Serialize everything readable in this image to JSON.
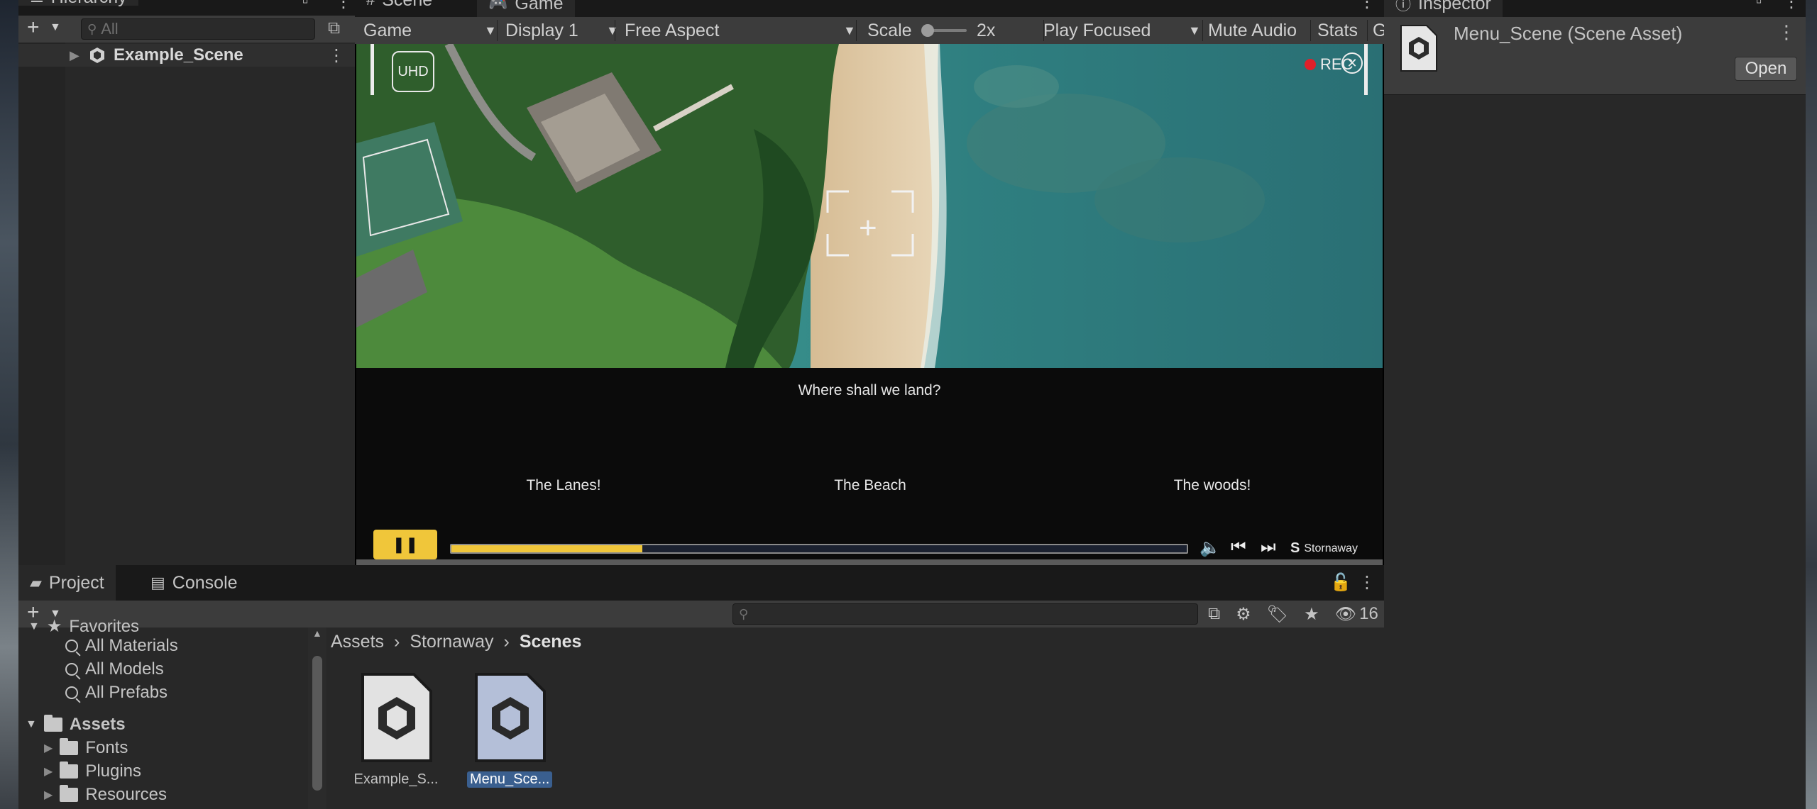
{
  "hierarchy": {
    "tab_label": "Hierarchy",
    "search_placeholder": "All",
    "scene_name": "Example_Scene"
  },
  "game": {
    "tab_scene": "Scene",
    "tab_game": "Game",
    "mode": "Game",
    "display": "Display 1",
    "aspect": "Free Aspect",
    "scale_label": "Scale",
    "scale_value": "2x",
    "play_mode": "Play Focused",
    "mute": "Mute Audio",
    "stats": "Stats",
    "gizmos_fragment": "G",
    "viewport": {
      "uhd": "UHD",
      "rec": "REC",
      "question": "Where shall we land?",
      "choices": [
        "The Lanes!",
        "The Beach",
        "The woods!"
      ],
      "brand": "Stornaway",
      "progress": 0.26
    }
  },
  "inspector": {
    "tab_label": "Inspector",
    "title": "Menu_Scene (Scene Asset)",
    "open_label": "Open"
  },
  "project": {
    "tab_project": "Project",
    "tab_console": "Console",
    "hidden_count": "16",
    "favorites_label": "Favorites",
    "favorites": [
      "All Materials",
      "All Models",
      "All Prefabs"
    ],
    "assets_label": "Assets",
    "folders": [
      "Fonts",
      "Plugins",
      "Resources"
    ],
    "breadcrumb": [
      "Assets",
      "Stornaway",
      "Scenes"
    ],
    "files": [
      "Example_S...",
      "Menu_Sce..."
    ]
  },
  "colors": {
    "accent_yellow": "#f0c63a",
    "panel_bg": "#282828",
    "toolbar_bg": "#3c3c3c",
    "selection_blue": "#3a5f8f",
    "rec_red": "#e0202a"
  }
}
